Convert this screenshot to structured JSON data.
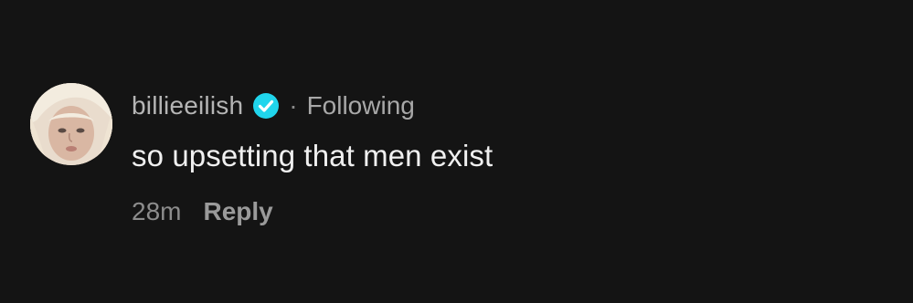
{
  "comment": {
    "avatar_icon": "user-avatar",
    "username": "billieeilish",
    "verified_icon": "verified-badge-icon",
    "separator": "·",
    "follow_status": "Following",
    "text": "so upsetting that men exist",
    "timestamp": "28m",
    "reply_label": "Reply",
    "colors": {
      "background": "#141414",
      "verified": "#20d5ec",
      "text": "#f0f0f0",
      "muted": "#8c8c8c"
    }
  }
}
